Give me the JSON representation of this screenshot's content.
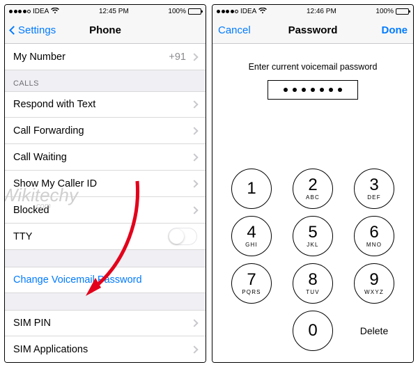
{
  "left": {
    "status": {
      "carrier": "IDEA",
      "time": "12:45 PM",
      "battery": "100%"
    },
    "nav": {
      "back": "Settings",
      "title": "Phone"
    },
    "rows": {
      "my_number_label": "My Number",
      "my_number_value": "+91",
      "calls_header": "CALLS",
      "respond": "Respond with Text",
      "forwarding": "Call Forwarding",
      "waiting": "Call Waiting",
      "caller_id": "Show My Caller ID",
      "blocked": "Blocked",
      "tty": "TTY",
      "change_vm": "Change Voicemail Password",
      "sim_pin": "SIM PIN",
      "sim_apps": "SIM Applications"
    },
    "watermark": {
      "main": "Wikitechy",
      "sub": ".com"
    }
  },
  "right": {
    "status": {
      "carrier": "IDEA",
      "time": "12:46 PM",
      "battery": "100%"
    },
    "nav": {
      "cancel": "Cancel",
      "title": "Password",
      "done": "Done"
    },
    "prompt": "Enter current voicemail password",
    "password_dots": 7,
    "keypad": [
      {
        "num": "1",
        "let": ""
      },
      {
        "num": "2",
        "let": "ABC"
      },
      {
        "num": "3",
        "let": "DEF"
      },
      {
        "num": "4",
        "let": "GHI"
      },
      {
        "num": "5",
        "let": "JKL"
      },
      {
        "num": "6",
        "let": "MNO"
      },
      {
        "num": "7",
        "let": "PQRS"
      },
      {
        "num": "8",
        "let": "TUV"
      },
      {
        "num": "9",
        "let": "WXYZ"
      },
      {
        "num": "0",
        "let": ""
      }
    ],
    "delete": "Delete"
  }
}
